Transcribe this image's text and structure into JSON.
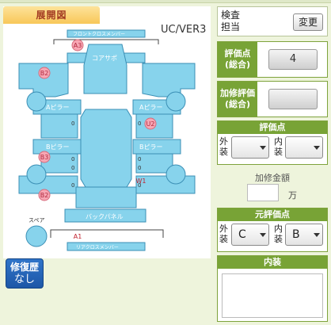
{
  "diagram": {
    "title": "展開図",
    "model": "UC/VER3",
    "parts": {
      "front_cross_member": "フロントクロスメンバー",
      "core_support": "コアサポ",
      "a_pillar_left": "Aピラー",
      "a_pillar_right": "Aピラー",
      "b_pillar_left": "Bピラー",
      "b_pillar_right": "Bピラー",
      "back_panel": "バックパネル",
      "rear_cross_member": "リアクロスメンバー",
      "spare": "スペア",
      "side_marks": [
        "0",
        "0",
        "0",
        "0",
        "0",
        "0",
        "0",
        "0"
      ]
    },
    "damage_marks": [
      {
        "code": "A3",
        "where": "front cross member"
      },
      {
        "code": "B2",
        "where": "front left fender"
      },
      {
        "code": "U2",
        "where": "right center"
      },
      {
        "code": "B3",
        "where": "left rear tire area"
      },
      {
        "code": "W1",
        "where": "rear right"
      },
      {
        "code": "B2",
        "where": "rear left"
      },
      {
        "code": "A1",
        "where": "rear cross member"
      }
    ]
  },
  "repair_history": {
    "label": "修復歴",
    "value": "なし"
  },
  "inspector": {
    "label_line1": "検査",
    "label_line2": "担当",
    "change_button": "変更"
  },
  "overall_score": {
    "label_line1": "評価点",
    "label_line2": "(総合)",
    "value": "4"
  },
  "repair_score": {
    "label_line1": "加修評価",
    "label_line2": "(総合)",
    "value": ""
  },
  "score_group": {
    "header": "評価点",
    "exterior_label_1": "外",
    "exterior_label_2": "装",
    "exterior_value": "",
    "interior_label_1": "内",
    "interior_label_2": "装",
    "interior_value": ""
  },
  "repair_amount": {
    "label": "加修金額",
    "value": "",
    "unit": "万"
  },
  "original_score": {
    "header": "元評価点",
    "exterior_label_1": "外",
    "exterior_label_2": "装",
    "exterior_value": "C",
    "interior_label_1": "内",
    "interior_label_2": "装",
    "interior_value": "B"
  },
  "interior_notes": {
    "header": "内装",
    "value": ""
  },
  "colors": {
    "accent_green": "#78a336",
    "panel_blue": "#87d3ec",
    "damage_pink": "#f7a7b4",
    "title_tab": "#f8c759"
  }
}
